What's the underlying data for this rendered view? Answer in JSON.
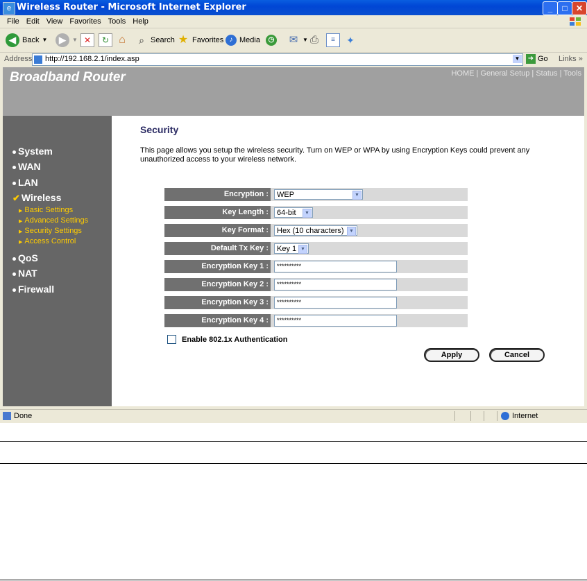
{
  "window": {
    "title": "Wireless Router - Microsoft Internet Explorer",
    "minimize": "_",
    "maximize": "□",
    "close": "✕"
  },
  "menu": [
    "File",
    "Edit",
    "View",
    "Favorites",
    "Tools",
    "Help"
  ],
  "toolbar": {
    "back": "Back",
    "search": "Search",
    "favorites": "Favorites",
    "media": "Media"
  },
  "address": {
    "label": "Address",
    "url": "http://192.168.2.1/index.asp",
    "go": "Go",
    "links": "Links"
  },
  "header": {
    "brand": "Broadband Router",
    "nav": [
      "HOME",
      "General Setup",
      "Status",
      "Tools"
    ],
    "separator": " | "
  },
  "sidebar": {
    "items": [
      {
        "label": "System"
      },
      {
        "label": "WAN"
      },
      {
        "label": "LAN"
      },
      {
        "label": "Wireless",
        "active": true
      },
      {
        "label": "QoS"
      },
      {
        "label": "NAT"
      },
      {
        "label": "Firewall"
      }
    ],
    "subitems": [
      "Basic Settings",
      "Advanced Settings",
      "Security Settings",
      "Access Control"
    ]
  },
  "main": {
    "title": "Security",
    "description": "This page allows you setup the wireless security. Turn on WEP or WPA by using Encryption Keys could prevent any unauthorized access to your wireless network.",
    "fields": {
      "encryption": {
        "label": "Encryption :",
        "value": "WEP"
      },
      "key_length": {
        "label": "Key Length :",
        "value": "64-bit"
      },
      "key_format": {
        "label": "Key Format :",
        "value": "Hex (10 characters)"
      },
      "default_tx_key": {
        "label": "Default Tx Key :",
        "value": "Key 1"
      },
      "key1": {
        "label": "Encryption Key 1 :",
        "value": "**********"
      },
      "key2": {
        "label": "Encryption Key 2 :",
        "value": "**********"
      },
      "key3": {
        "label": "Encryption Key 3 :",
        "value": "**********"
      },
      "key4": {
        "label": "Encryption Key 4 :",
        "value": "**********"
      }
    },
    "enable_8021x": "Enable 802.1x Authentication",
    "apply": "Apply",
    "cancel": "Cancel"
  },
  "status": {
    "done": "Done",
    "zone": "Internet"
  }
}
